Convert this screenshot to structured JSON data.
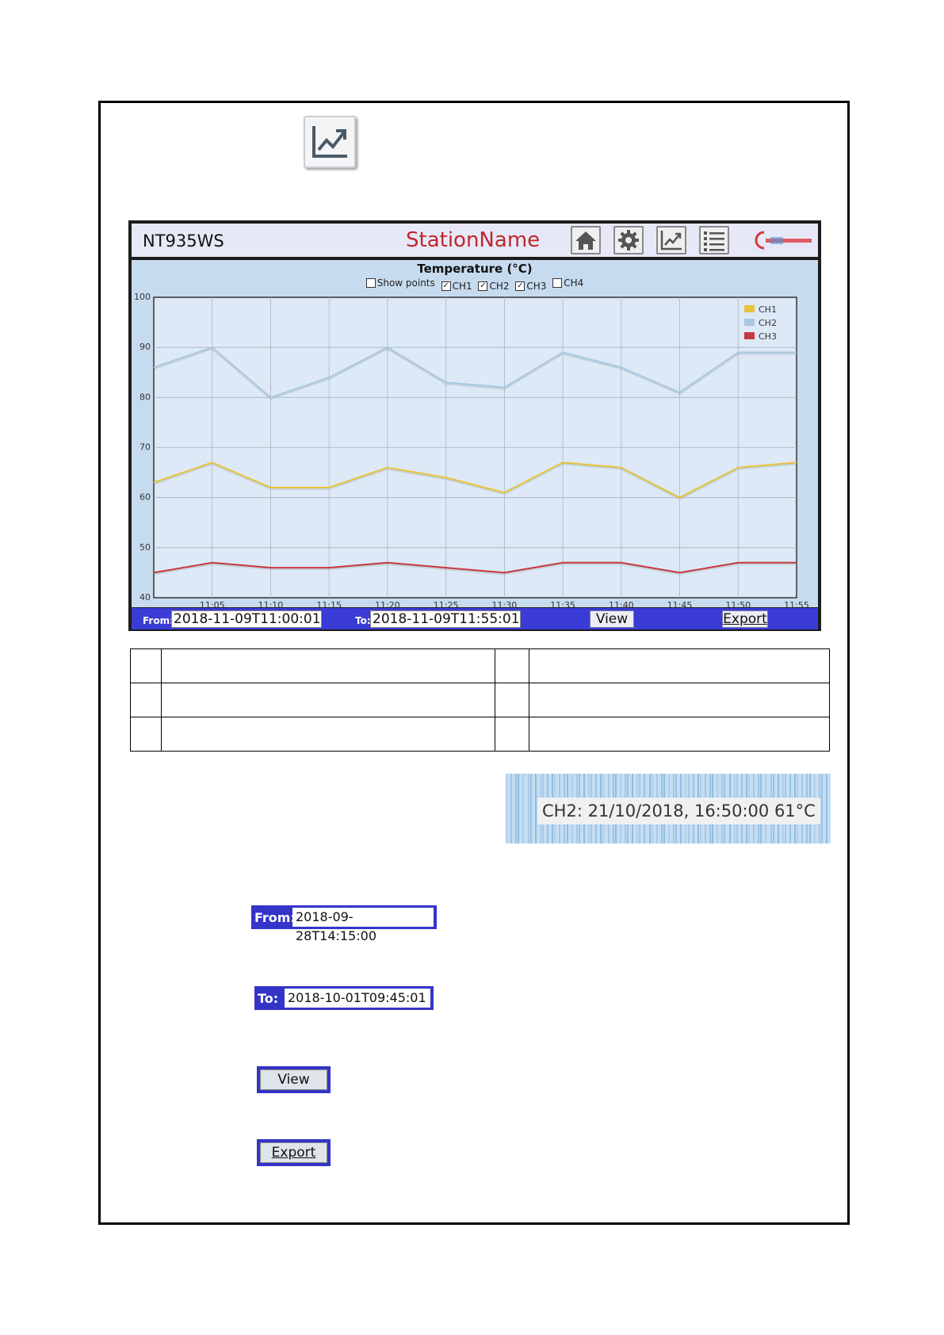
{
  "header": {
    "model": "NT935WS",
    "station_name": "StationName"
  },
  "toolbar": {
    "buttons": [
      "home-icon",
      "gear-icon",
      "chart-icon",
      "list-icon"
    ]
  },
  "chart": {
    "title": "Temperature (°C)",
    "options": [
      {
        "label": "Show points",
        "checked": false
      },
      {
        "label": "CH1",
        "checked": true
      },
      {
        "label": "CH2",
        "checked": true
      },
      {
        "label": "CH3",
        "checked": true
      },
      {
        "label": "CH4",
        "checked": false
      }
    ]
  },
  "chart_data": {
    "type": "line",
    "title": "Temperature (°C)",
    "x": [
      "11:00",
      "11:05",
      "11:10",
      "11:15",
      "11:20",
      "11:25",
      "11:30",
      "11:35",
      "11:40",
      "11:45",
      "11:50",
      "11:55"
    ],
    "x_tick_labels": [
      "11:05",
      "11:10",
      "11:15",
      "11:20",
      "11:25",
      "11:30",
      "11:35",
      "11:40",
      "11:45",
      "11:50",
      "11:55"
    ],
    "y_tick_labels": [
      "100",
      "90",
      "80",
      "70",
      "60",
      "50",
      "40"
    ],
    "ylim": [
      40,
      100
    ],
    "grid": true,
    "legend_position": "top-right",
    "series": [
      {
        "name": "CH1",
        "color": "#e8c23a",
        "values": [
          63,
          67,
          62,
          62,
          66,
          64,
          61,
          67,
          66,
          60,
          66,
          67
        ]
      },
      {
        "name": "CH2",
        "color": "#a9c8e2",
        "values": [
          86,
          90,
          80,
          84,
          90,
          83,
          82,
          89,
          86,
          81,
          89,
          89
        ]
      },
      {
        "name": "CH3",
        "color": "#c8383e",
        "values": [
          45,
          47,
          46,
          46,
          47,
          46,
          45,
          47,
          47,
          45,
          47,
          47
        ]
      }
    ]
  },
  "footer": {
    "from_label": "From:",
    "from_value": "2018-11-09T11:00:01",
    "to_label": "To:",
    "to_value": "2018-11-09T11:55:01",
    "view_label": "View",
    "export_label": "Export"
  },
  "tooltip": {
    "text": "CH2: 21/10/2018, 16:50:00 61°C"
  },
  "examples": {
    "from_label": "From:",
    "from_value": "2018-09-28T14:15:00",
    "to_label": "To:",
    "to_value": "2018-10-01T09:45:01",
    "view_label": "View",
    "export_label": "Export"
  }
}
